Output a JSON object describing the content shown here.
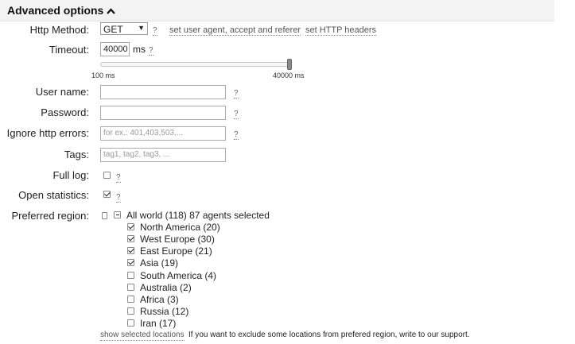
{
  "header": {
    "title": "Advanced options",
    "icon": "chevron-up-icon",
    "background": "#f3f3f3"
  },
  "http_method": {
    "label": "Http Method:",
    "value": "GET",
    "help": "?",
    "link_user_agent": "set user agent, accept and referer",
    "link_headers": "set HTTP headers"
  },
  "timeout": {
    "label": "Timeout:",
    "value": "40000",
    "unit": "ms",
    "help": "?",
    "slider_min_label": "100 ms",
    "slider_max_label": "40000 ms",
    "slider_min": 100,
    "slider_max": 40000,
    "slider_value": 40000
  },
  "username": {
    "label": "User name:",
    "value": "",
    "help": "?"
  },
  "password": {
    "label": "Password:",
    "value": "",
    "help": "?"
  },
  "ignore_errors": {
    "label": "Ignore http errors:",
    "placeholder": "for ex.: 401,403,503,...",
    "help": "?"
  },
  "tags": {
    "label": "Tags:",
    "placeholder": "tag1, tag2, tag3, ..."
  },
  "full_log": {
    "label": "Full log:",
    "checked": false,
    "help": "?"
  },
  "open_statistics": {
    "label": "Open statistics:",
    "checked": true,
    "help": "?"
  },
  "preferred_region": {
    "label": "Preferred region:",
    "all_world": "All world (118) 87 agents selected",
    "regions": [
      {
        "name": "North America (20)",
        "checked": true
      },
      {
        "name": "West Europe (30)",
        "checked": true
      },
      {
        "name": "East Europe (21)",
        "checked": true
      },
      {
        "name": "Asia (19)",
        "checked": true
      },
      {
        "name": "South America (4)",
        "checked": false
      },
      {
        "name": "Australia (2)",
        "checked": false
      },
      {
        "name": "Africa (3)",
        "checked": false
      },
      {
        "name": "Russia (12)",
        "checked": false
      },
      {
        "name": "Iran (17)",
        "checked": false
      }
    ],
    "show_selected_link": "show selected locations",
    "note": "If you want to exclude some locations from prefered region, write to our support."
  }
}
